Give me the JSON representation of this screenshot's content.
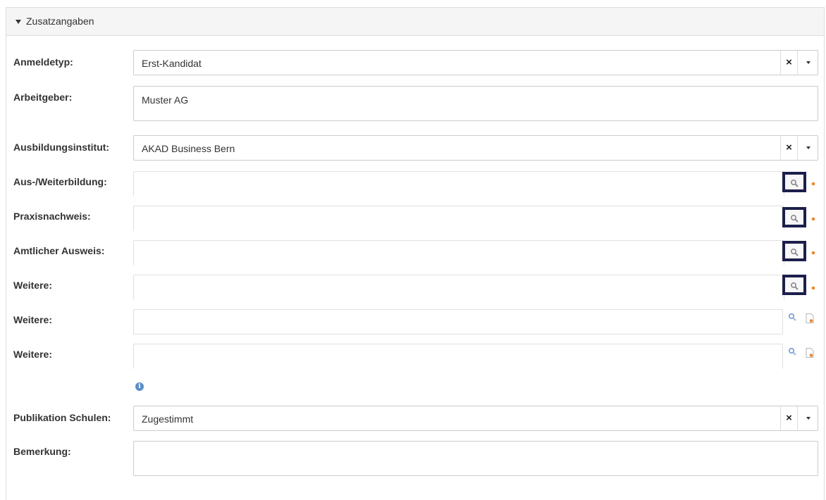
{
  "panel": {
    "title": "Zusatzangaben"
  },
  "fields": {
    "anmeldetyp": {
      "label": "Anmeldetyp:",
      "value": "Erst-Kandidat",
      "clear": "×"
    },
    "arbeitgeber": {
      "label": "Arbeitgeber:",
      "value": "Muster AG"
    },
    "ausbildungsinstitut": {
      "label": "Ausbildungsinstitut:",
      "value": "AKAD Business Bern",
      "clear": "×"
    },
    "aus_weiterbildung": {
      "label": "Aus-/Weiterbildung:"
    },
    "praxisnachweis": {
      "label": "Praxisnachweis:"
    },
    "amtlicher_ausweis": {
      "label": "Amtlicher Ausweis:"
    },
    "weitere_1": {
      "label": "Weitere:"
    },
    "weitere_2": {
      "label": "Weitere:"
    },
    "weitere_3": {
      "label": "Weitere:"
    },
    "info": {
      "glyph": "i"
    },
    "publikation_schulen": {
      "label": "Publikation Schulen:",
      "value": "Zugestimmt",
      "clear": "×"
    },
    "bemerkung": {
      "label": "Bemerkung:",
      "value": ""
    }
  },
  "icons": {
    "search": "search-icon",
    "document": "document-icon",
    "highlight_color": "#1c1f4c",
    "doc_accent": "#e8892e"
  }
}
